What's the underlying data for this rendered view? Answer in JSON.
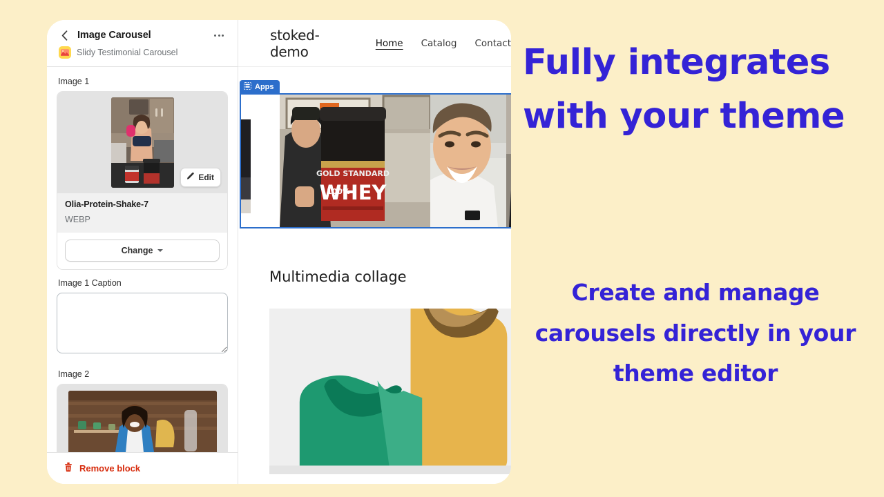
{
  "theme": {
    "page_bg": "#FCEFC8",
    "accent_blue": "#3423D6",
    "editor_blue": "#2C6ECB",
    "danger_red": "#D72C0D"
  },
  "sidebar": {
    "back_icon": "chevron-left-icon",
    "title": "Image Carousel",
    "menu_icon": "more-horizontal-icon",
    "app_icon": "slidy-app-icon",
    "app_name": "Slidy Testimonial Carousel",
    "fields": [
      {
        "label": "Image 1"
      },
      {
        "label": "Image 1 Caption"
      },
      {
        "label": "Image 2"
      }
    ],
    "media": {
      "edit_label": "Edit",
      "edit_icon": "pencil-icon",
      "file_name": "Olia-Protein-Shake-7",
      "file_type": "WEBP",
      "change_label": "Change",
      "change_caret_icon": "chevron-down-icon"
    },
    "caption": {
      "value": "",
      "placeholder": ""
    },
    "footer": {
      "remove_label": "Remove block",
      "remove_icon": "trash-icon"
    }
  },
  "preview": {
    "store_name": "stoked-demo",
    "nav": [
      {
        "label": "Home",
        "active": true
      },
      {
        "label": "Catalog",
        "active": false
      },
      {
        "label": "Contact",
        "active": false
      }
    ],
    "apps_badge": {
      "label": "Apps",
      "icon": "apps-grid-icon"
    },
    "carousel": {
      "slides": [
        {
          "alt": "testimonial-photo-partial-left"
        },
        {
          "alt": "man-holding-gold-standard-whey"
        },
        {
          "alt": "smiling-young-man-testimonial"
        },
        {
          "alt": "woman-holding-whey-tub"
        }
      ]
    },
    "section_title": "Multimedia collage",
    "collage_placeholder": "apparel-placeholder-graphic"
  },
  "marketing": {
    "headline": "Fully integrates with your theme",
    "subline": "Create and manage carousels directly in your theme editor"
  }
}
